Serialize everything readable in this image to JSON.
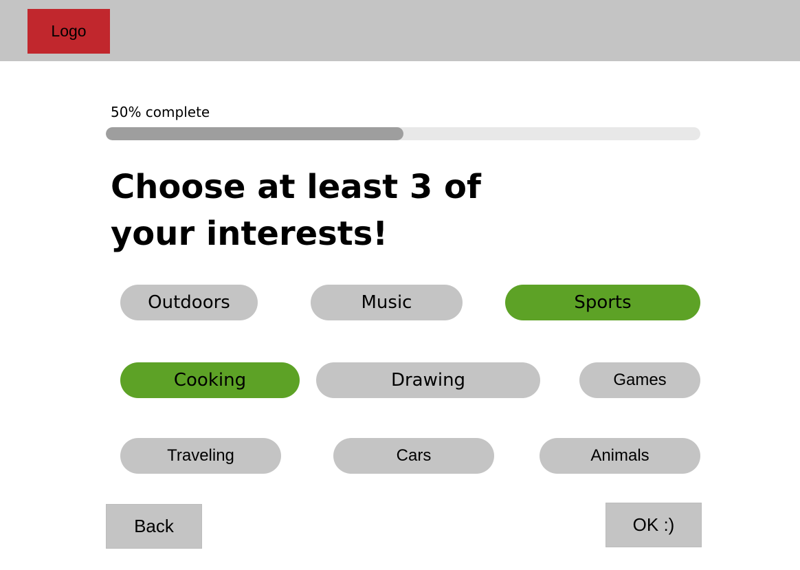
{
  "header": {
    "logo_label": "Logo"
  },
  "progress": {
    "label": "50% complete",
    "percent": 50
  },
  "heading": {
    "line1": "Choose at least 3 of",
    "line2": "your interests!"
  },
  "interests": [
    {
      "label": "Outdoors",
      "selected": false
    },
    {
      "label": "Music",
      "selected": false
    },
    {
      "label": "Sports",
      "selected": true
    },
    {
      "label": "Cooking",
      "selected": true
    },
    {
      "label": "Drawing",
      "selected": false
    },
    {
      "label": "Games",
      "selected": false
    },
    {
      "label": "Traveling",
      "selected": false
    },
    {
      "label": "Cars",
      "selected": false
    },
    {
      "label": "Animals",
      "selected": false
    }
  ],
  "actions": {
    "back_label": "Back",
    "ok_label": "OK :)"
  },
  "colors": {
    "header": "#c4c4c4",
    "logo": "#c1272d",
    "chip_default": "#c4c4c4",
    "chip_selected": "#5da226",
    "progress_fill": "#9e9e9e",
    "progress_track": "#e8e8e8"
  }
}
